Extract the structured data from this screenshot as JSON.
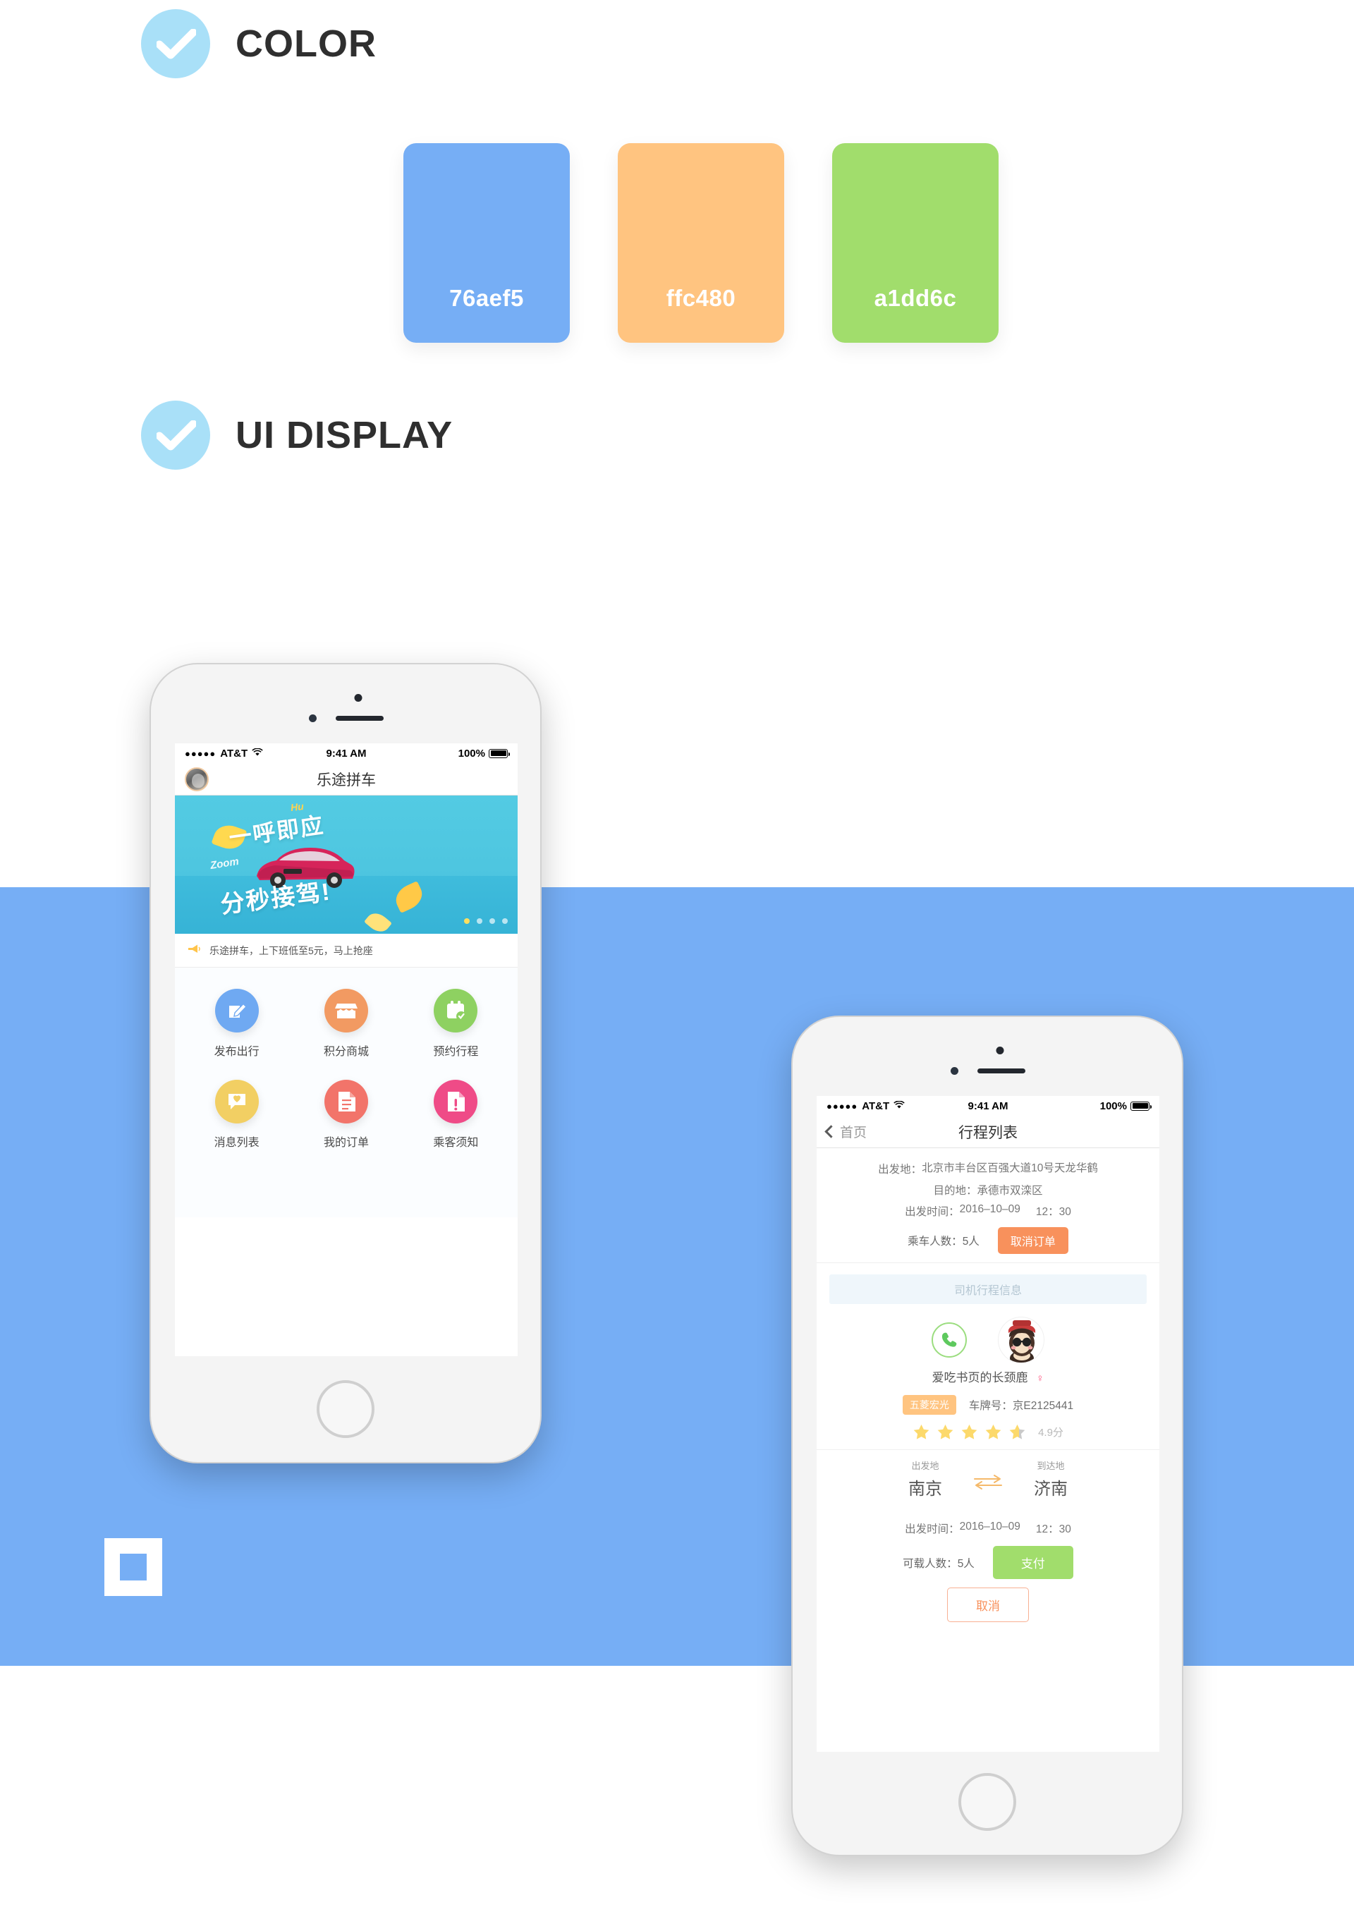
{
  "sections": {
    "color": {
      "title": "COLOR",
      "icon": "check-circle-icon"
    },
    "ui": {
      "title": "UI DISPLAY",
      "icon": "check-circle-icon"
    }
  },
  "palette": [
    {
      "hex": "76aef5",
      "css": "#76aef5",
      "label": "76aef5"
    },
    {
      "hex": "ffc480",
      "css": "#ffc480",
      "label": "ffc480"
    },
    {
      "hex": "a1dd6c",
      "css": "#a1dd6c",
      "label": "a1dd6c"
    }
  ],
  "brand_mark": "square-outline-mark",
  "phone_home": {
    "status_bar": {
      "carrier": "AT&T",
      "signal_dots": "●●●●●",
      "wifi": "wifi-icon",
      "time": "9:41 AM",
      "battery_pct": "100%"
    },
    "navbar": {
      "avatar": "user-avatar",
      "title": "乐途拼车"
    },
    "banner": {
      "line1": "一呼即应",
      "line2": "分秒接驾!",
      "zoom_word": "Zoom",
      "hu_word": "Hu",
      "dots_total": 4,
      "dot_active": 1
    },
    "promo": {
      "icon": "megaphone-icon",
      "text": "乐途拼车，上下班低至5元，马上抢座"
    },
    "grid": [
      {
        "label": "发布出行",
        "icon": "compose-icon",
        "color": "#6fa9f2"
      },
      {
        "label": "积分商城",
        "icon": "shop-icon",
        "color": "#f29a62"
      },
      {
        "label": "预约行程",
        "icon": "calendar-check-icon",
        "color": "#8ed161"
      },
      {
        "label": "消息列表",
        "icon": "chat-heart-icon",
        "color": "#f2cf63"
      },
      {
        "label": "我的订单",
        "icon": "document-icon",
        "color": "#f2746a"
      },
      {
        "label": "乘客须知",
        "icon": "document-alert-icon",
        "color": "#ef4b87"
      }
    ]
  },
  "phone_trip": {
    "status_bar": {
      "carrier": "AT&T",
      "signal_dots": "●●●●●",
      "wifi": "wifi-icon",
      "time": "9:41 AM",
      "battery_pct": "100%"
    },
    "navbar": {
      "back_label": "首页",
      "title": "行程列表"
    },
    "order": {
      "origin_label": "出发地：",
      "origin_value": "北京市丰台区百强大道10号天龙华鹤",
      "dest_label": "目的地：",
      "dest_value": "承德市双滦区",
      "time_label": "出发时间：",
      "time_date": "2016–10–09",
      "time_clock": "12：30",
      "pax_label": "乘车人数：",
      "pax_value": "5人",
      "cancel_order_btn": "取消订单"
    },
    "driver_section_title": "司机行程信息",
    "driver": {
      "call_icon": "phone-call-icon",
      "avatar": "driver-avatar",
      "name": "爱吃书页的长颈鹿",
      "gender": "♀",
      "car_model": "五菱宏光",
      "plate_label": "车牌号：",
      "plate_value": "京E2125441",
      "stars": 5,
      "stars_filled": 4.5,
      "score": "4.9分"
    },
    "route": {
      "from_label": "出发地",
      "from_value": "南京",
      "swap_icon": "swap-arrows-icon",
      "to_label": "到达地",
      "to_value": "济南"
    },
    "depart": {
      "label": "出发时间：",
      "date": "2016–10–09",
      "clock": "12：30"
    },
    "capacity_label": "可载人数：",
    "capacity_value": "5人",
    "pay_btn": "支付",
    "cancel_btn": "取消"
  }
}
